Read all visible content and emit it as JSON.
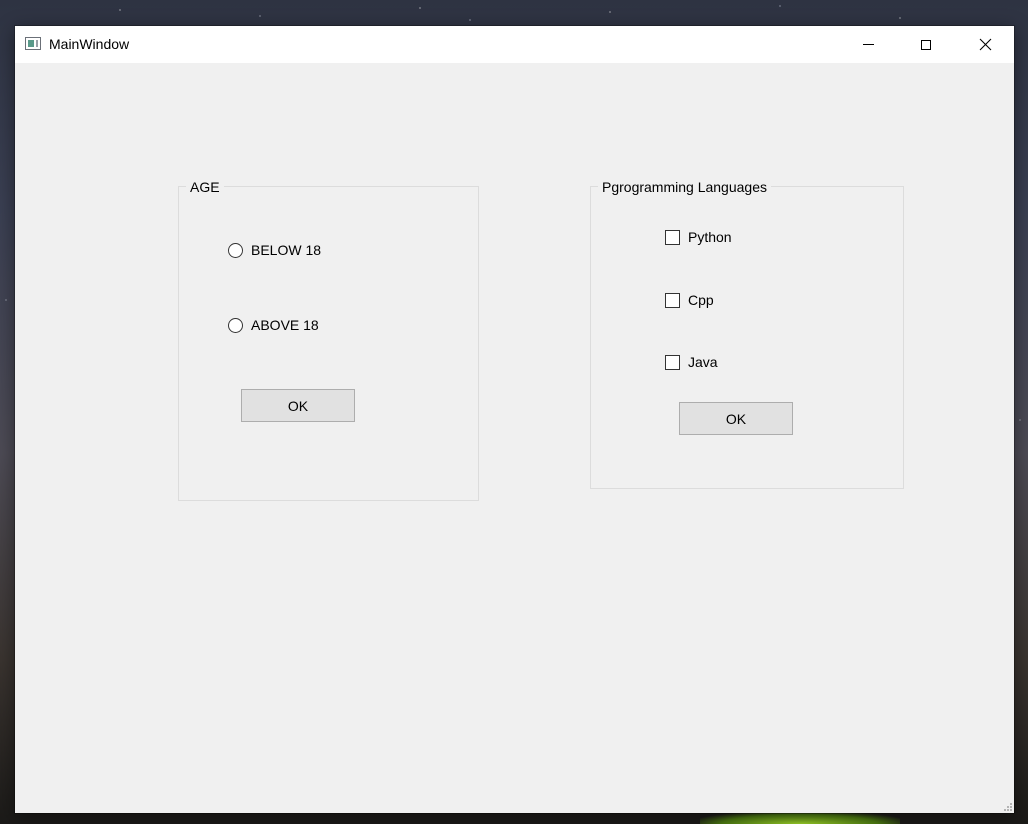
{
  "window": {
    "title": "MainWindow",
    "controls": {
      "minimize_icon": "minimize-icon",
      "maximize_icon": "maximize-icon",
      "close_icon": "close-icon"
    }
  },
  "age_group": {
    "title": "AGE",
    "options": [
      {
        "label": "BELOW 18",
        "checked": false
      },
      {
        "label": "ABOVE 18",
        "checked": false
      }
    ],
    "ok_label": "OK"
  },
  "languages_group": {
    "title": "Pgrogramming Languages",
    "options": [
      {
        "label": "Python",
        "checked": false
      },
      {
        "label": "Cpp",
        "checked": false
      },
      {
        "label": "Java",
        "checked": false
      }
    ],
    "ok_label": "OK"
  },
  "colors": {
    "window_background": "#f0f0f0",
    "titlebar_background": "#ffffff",
    "button_face": "#e1e1e1",
    "button_border": "#adadad",
    "groupbox_border": "#dcdcdc"
  }
}
